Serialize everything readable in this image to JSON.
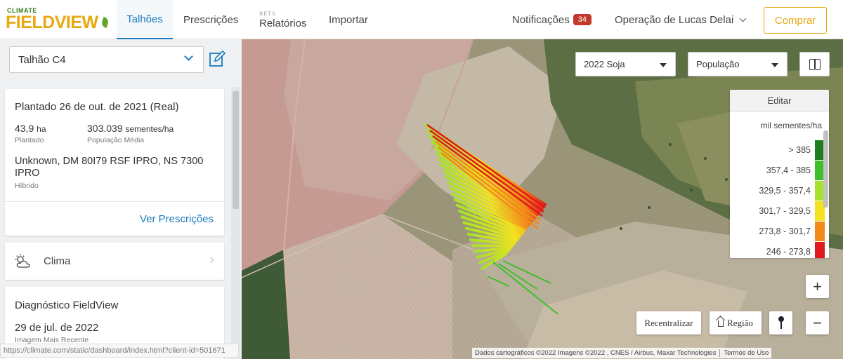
{
  "header": {
    "logo_small": "CLIMATE",
    "logo_big": "FIELDVIEW",
    "tabs": [
      {
        "label": "Talhões",
        "active": true
      },
      {
        "label": "Prescrições",
        "active": false
      },
      {
        "label": "Relatórios",
        "beta": "BETA",
        "active": false
      },
      {
        "label": "Importar",
        "active": false
      }
    ],
    "notifications_label": "Notificações",
    "notifications_count": "34",
    "operation_label": "Operação de Lucas Delai",
    "buy_label": "Comprar",
    "accent_color": "#1a7bbf",
    "brand_color": "#e8a80f"
  },
  "sidebar": {
    "field_selected": "Talhão C4",
    "planting_card": {
      "title": "Plantado 26 de out. de 2021 (Real)",
      "area_value": "43,9",
      "area_unit": "ha",
      "area_label": "Plantado",
      "population_value": "303.039",
      "population_unit": "sementes/ha",
      "population_label": "População Média",
      "hybrid_value": "Unknown, DM 80I79 RSF IPRO, NS 7300 IPRO",
      "hybrid_label": "Híbrido",
      "link_label": "Ver Prescrições"
    },
    "weather_card": {
      "label": "Clima",
      "icon": "partly-cloudy-icon"
    },
    "diagnostic_card": {
      "title": "Diagnóstico FieldView",
      "date": "29 de jul. de 2022",
      "date_label": "Imagem Mais Recente"
    },
    "status_url": "https://climate.com/static/dashboard/index.html?client-id=501671"
  },
  "map": {
    "season_select": "2022 Soja",
    "layer_select": "População",
    "legend": {
      "edit_label": "Editar",
      "unit": "mil sementes/ha",
      "ranges": [
        {
          "label": "> 385",
          "color": "#1e7f1e"
        },
        {
          "label": "357,4 - 385",
          "color": "#3fbf2a"
        },
        {
          "label": "329,5 - 357,4",
          "color": "#a6e22a"
        },
        {
          "label": "301,7 - 329,5",
          "color": "#f2e21f"
        },
        {
          "label": "273,8 - 301,7",
          "color": "#f28a1a"
        },
        {
          "label": "246 - 273,8",
          "color": "#e01a1a"
        }
      ]
    },
    "buttons": {
      "recenter": "Recentralizar",
      "region": "Região",
      "zoom_in": "+",
      "zoom_out": "−"
    },
    "attribution": "Dados cartográficos ©2022 Imagens ©2022 , CNES / Airbus, Maxar Technologies",
    "terms": "Termos de Uso"
  }
}
